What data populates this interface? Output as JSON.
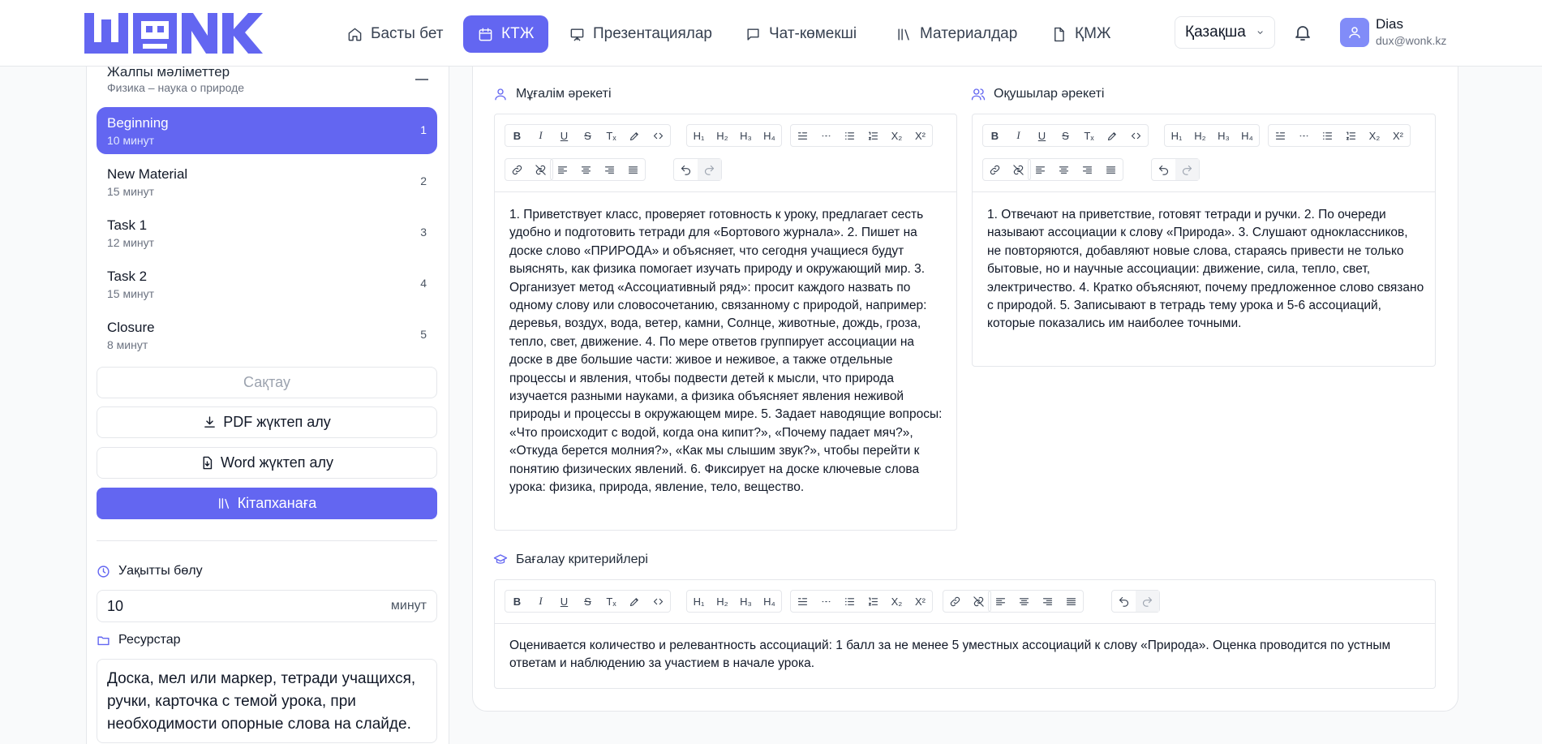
{
  "app": {
    "logo_text": "WONK"
  },
  "nav": [
    {
      "label": "Басты бет",
      "icon": "home-icon",
      "active": false
    },
    {
      "label": "КТЖ",
      "icon": "calendar-icon",
      "active": true
    },
    {
      "label": "Презентациялар",
      "icon": "presentation-icon",
      "active": false
    },
    {
      "label": "Чат-көмекші",
      "icon": "chat-icon",
      "active": false
    },
    {
      "label": "Материалдар",
      "icon": "library-icon",
      "active": false
    },
    {
      "label": "ҚМЖ",
      "icon": "file-icon",
      "active": false
    }
  ],
  "language": {
    "selected": "Қазақша"
  },
  "user": {
    "name": "Dias",
    "email": "dux@wonk.kz"
  },
  "sidebar": {
    "section_title": "Жалпы мәліметтер",
    "section_subtitle": "Физика – наука о природе",
    "stages": [
      {
        "title": "Beginning",
        "duration": "10 минут",
        "number": "1",
        "active": true
      },
      {
        "title": "New Material",
        "duration": "15 минут",
        "number": "2",
        "active": false
      },
      {
        "title": "Task 1",
        "duration": "12 минут",
        "number": "3",
        "active": false
      },
      {
        "title": "Task 2",
        "duration": "15 минут",
        "number": "4",
        "active": false
      },
      {
        "title": "Closure",
        "duration": "8 минут",
        "number": "5",
        "active": false
      }
    ],
    "save_label": "Сақтау",
    "pdf_label": "PDF жүктеп алу",
    "word_label": "Word жүктеп алу",
    "library_label": "Кітапханаға",
    "time_label": "Уақытты бөлу",
    "time_value": "10",
    "time_unit": "минут",
    "resources_label": "Ресурстар",
    "resources_value": "Доска, мел или маркер, тетради учащихся, ручки, карточка с темой урока, при необходимости опорные слова на слайде."
  },
  "editors": {
    "teacher": {
      "label": "Мұғалім әрекеті",
      "content": "1. Приветствует класс, проверяет готовность к уроку, предлагает сесть удобно и подготовить тетради для «Бортового журнала». 2. Пишет на доске слово «ПРИРОДА» и объясняет, что сегодня учащиеся будут выяснять, как физика помогает изучать природу и окружающий мир. 3. Организует метод «Ассоциативный ряд»: просит каждого назвать по одному слову или словосочетанию, связанному с природой, например: деревья, воздух, вода, ветер, камни, Солнце, животные, дождь, гроза, тепло, свет, движение. 4. По мере ответов группирует ассоциации на доске в две большие части: живое и неживое, а также отдельные процессы и явления, чтобы подвести детей к мысли, что природа изучается разными науками, а физика объясняет явления неживой природы и процессы в окружающем мире. 5. Задает наводящие вопросы: «Что происходит с водой, когда она кипит?», «Почему падает мяч?», «Откуда берется молния?», «Как мы слышим звук?», чтобы перейти к понятию физических явлений. 6. Фиксирует на доске ключевые слова урока: физика, природа, явление, тело, вещество."
    },
    "students": {
      "label": "Оқушылар әрекеті",
      "content": "1. Отвечают на приветствие, готовят тетради и ручки. 2. По очереди называют ассоциации к слову «Природа». 3. Слушают одноклассников, не повторяются, добавляют новые слова, стараясь привести не только бытовые, но и научные ассоциации: движение, сила, тепло, свет, электричество. 4. Кратко объясняют, почему предложенное слово связано с природой. 5. Записывают в тетрадь тему урока и 5-6 ассоциаций, которые показались им наиболее точными."
    },
    "assessment": {
      "label": "Бағалау критерийлері",
      "content": "Оценивается количество и релевантность ассоциаций: 1 балл за не менее 5 уместных ассоциаций к слову «Природа». Оценка проводится по устным ответам и наблюдению за участием в начале урока."
    }
  },
  "toolbar_labels": {
    "bold": "B",
    "italic": "I",
    "underline": "U",
    "strike": "S",
    "clear": "Tₓ",
    "h1": "H₁",
    "h2": "H₂",
    "h3": "H₃",
    "h4": "H₄",
    "subscript": "X₂",
    "superscript": "X²"
  },
  "colors": {
    "accent": "#6366f1"
  }
}
